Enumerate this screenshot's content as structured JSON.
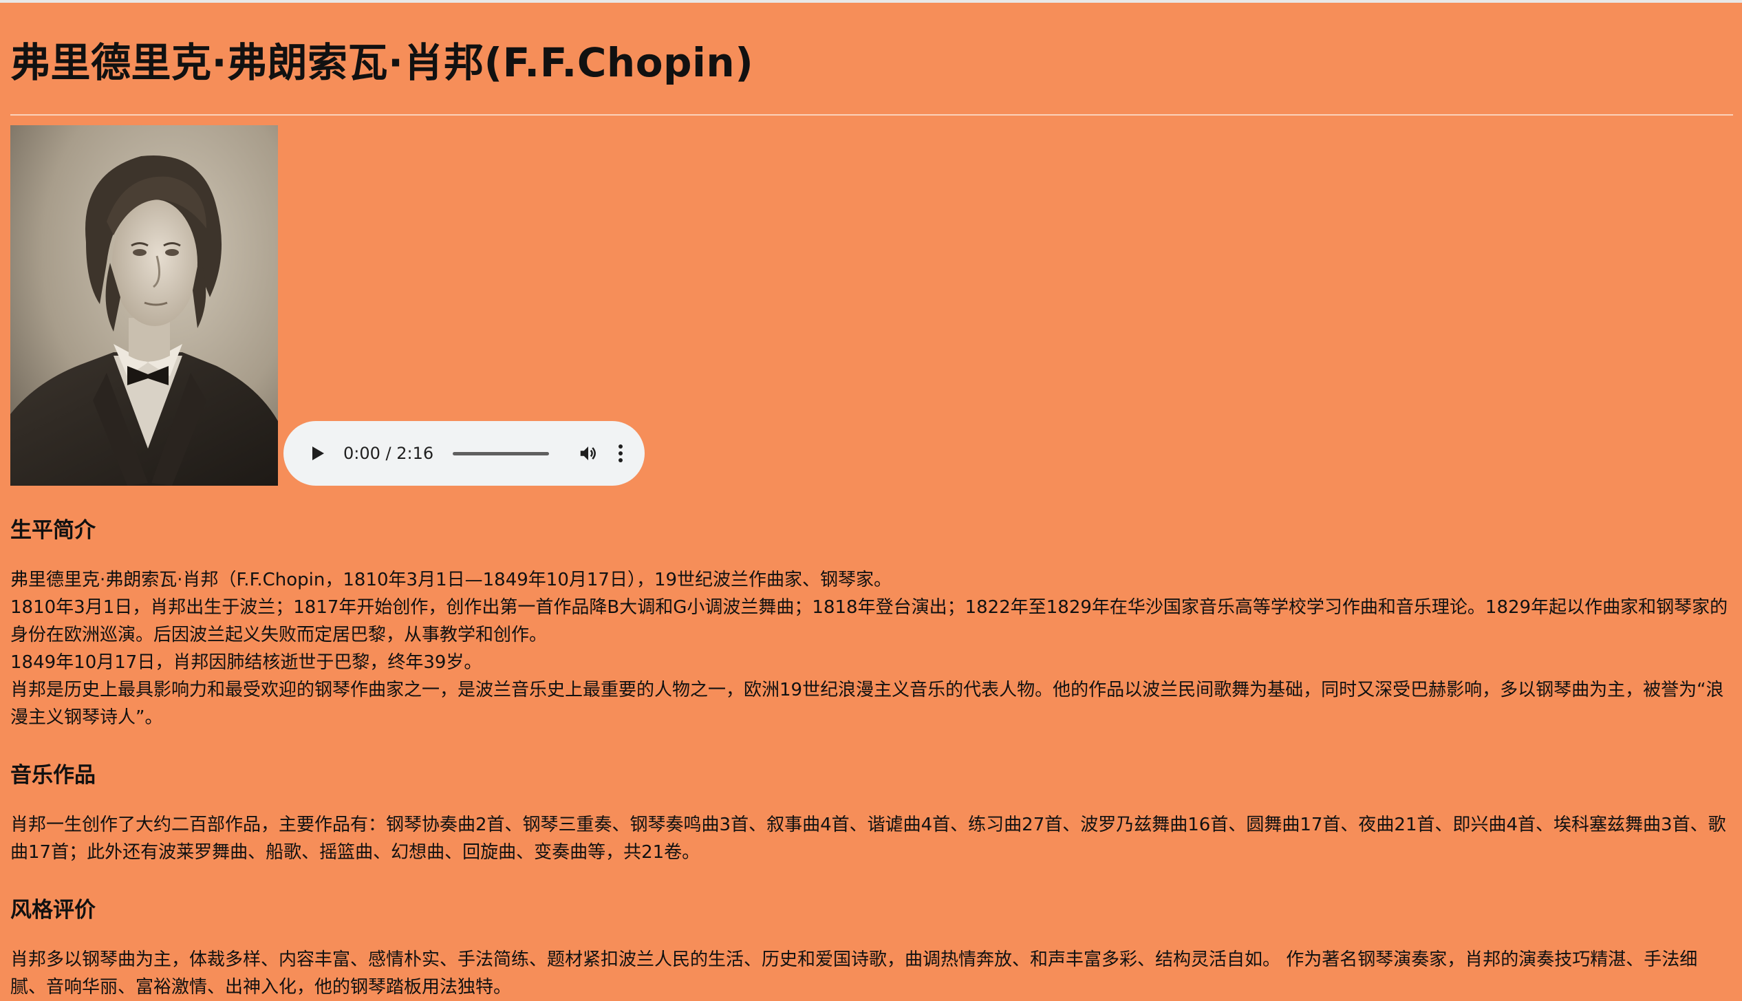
{
  "title": "弗里德里克·弗朗索瓦·肖邦(F.F.Chopin)",
  "portrait": {
    "alt": "Chopin portrait"
  },
  "audio": {
    "time": "0:00 / 2:16",
    "progress": 0
  },
  "sections": [
    {
      "heading": "生平简介",
      "lines": [
        "弗里德里克·弗朗索瓦·肖邦（F.F.Chopin，1810年3月1日—1849年10月17日），19世纪波兰作曲家、钢琴家。",
        "1810年3月1日，肖邦出生于波兰；1817年开始创作，创作出第一首作品降B大调和G小调波兰舞曲；1818年登台演出；1822年至1829年在华沙国家音乐高等学校学习作曲和音乐理论。1829年起以作曲家和钢琴家的身份在欧洲巡演。后因波兰起义失败而定居巴黎，从事教学和创作。",
        "1849年10月17日，肖邦因肺结核逝世于巴黎，终年39岁。",
        "肖邦是历史上最具影响力和最受欢迎的钢琴作曲家之一，是波兰音乐史上最重要的人物之一，欧洲19世纪浪漫主义音乐的代表人物。他的作品以波兰民间歌舞为基础，同时又深受巴赫影响，多以钢琴曲为主，被誉为“浪漫主义钢琴诗人”。"
      ]
    },
    {
      "heading": "音乐作品",
      "lines": [
        "肖邦一生创作了大约二百部作品，主要作品有：钢琴协奏曲2首、钢琴三重奏、钢琴奏鸣曲3首、叙事曲4首、谐谑曲4首、练习曲27首、波罗乃兹舞曲16首、圆舞曲17首、夜曲21首、即兴曲4首、埃科塞兹舞曲3首、歌曲17首；此外还有波莱罗舞曲、船歌、摇篮曲、幻想曲、回旋曲、变奏曲等，共21卷。"
      ]
    },
    {
      "heading": "风格评价",
      "lines": [
        "肖邦多以钢琴曲为主，体裁多样、内容丰富、感情朴实、手法简练、题材紧扣波兰人民的生活、历史和爱国诗歌，曲调热情奔放、和声丰富多彩、结构灵活自如。 作为著名钢琴演奏家，肖邦的演奏技巧精湛、手法细腻、音响华丽、富裕激情、出神入化，他的钢琴踏板用法独特。"
      ]
    }
  ],
  "colors": {
    "background": "#F68E59",
    "text": "#111111",
    "audio_bg": "#f1f3f4"
  },
  "icons": {
    "play": "play-icon",
    "volume": "volume-icon",
    "more": "more-vertical-icon"
  }
}
